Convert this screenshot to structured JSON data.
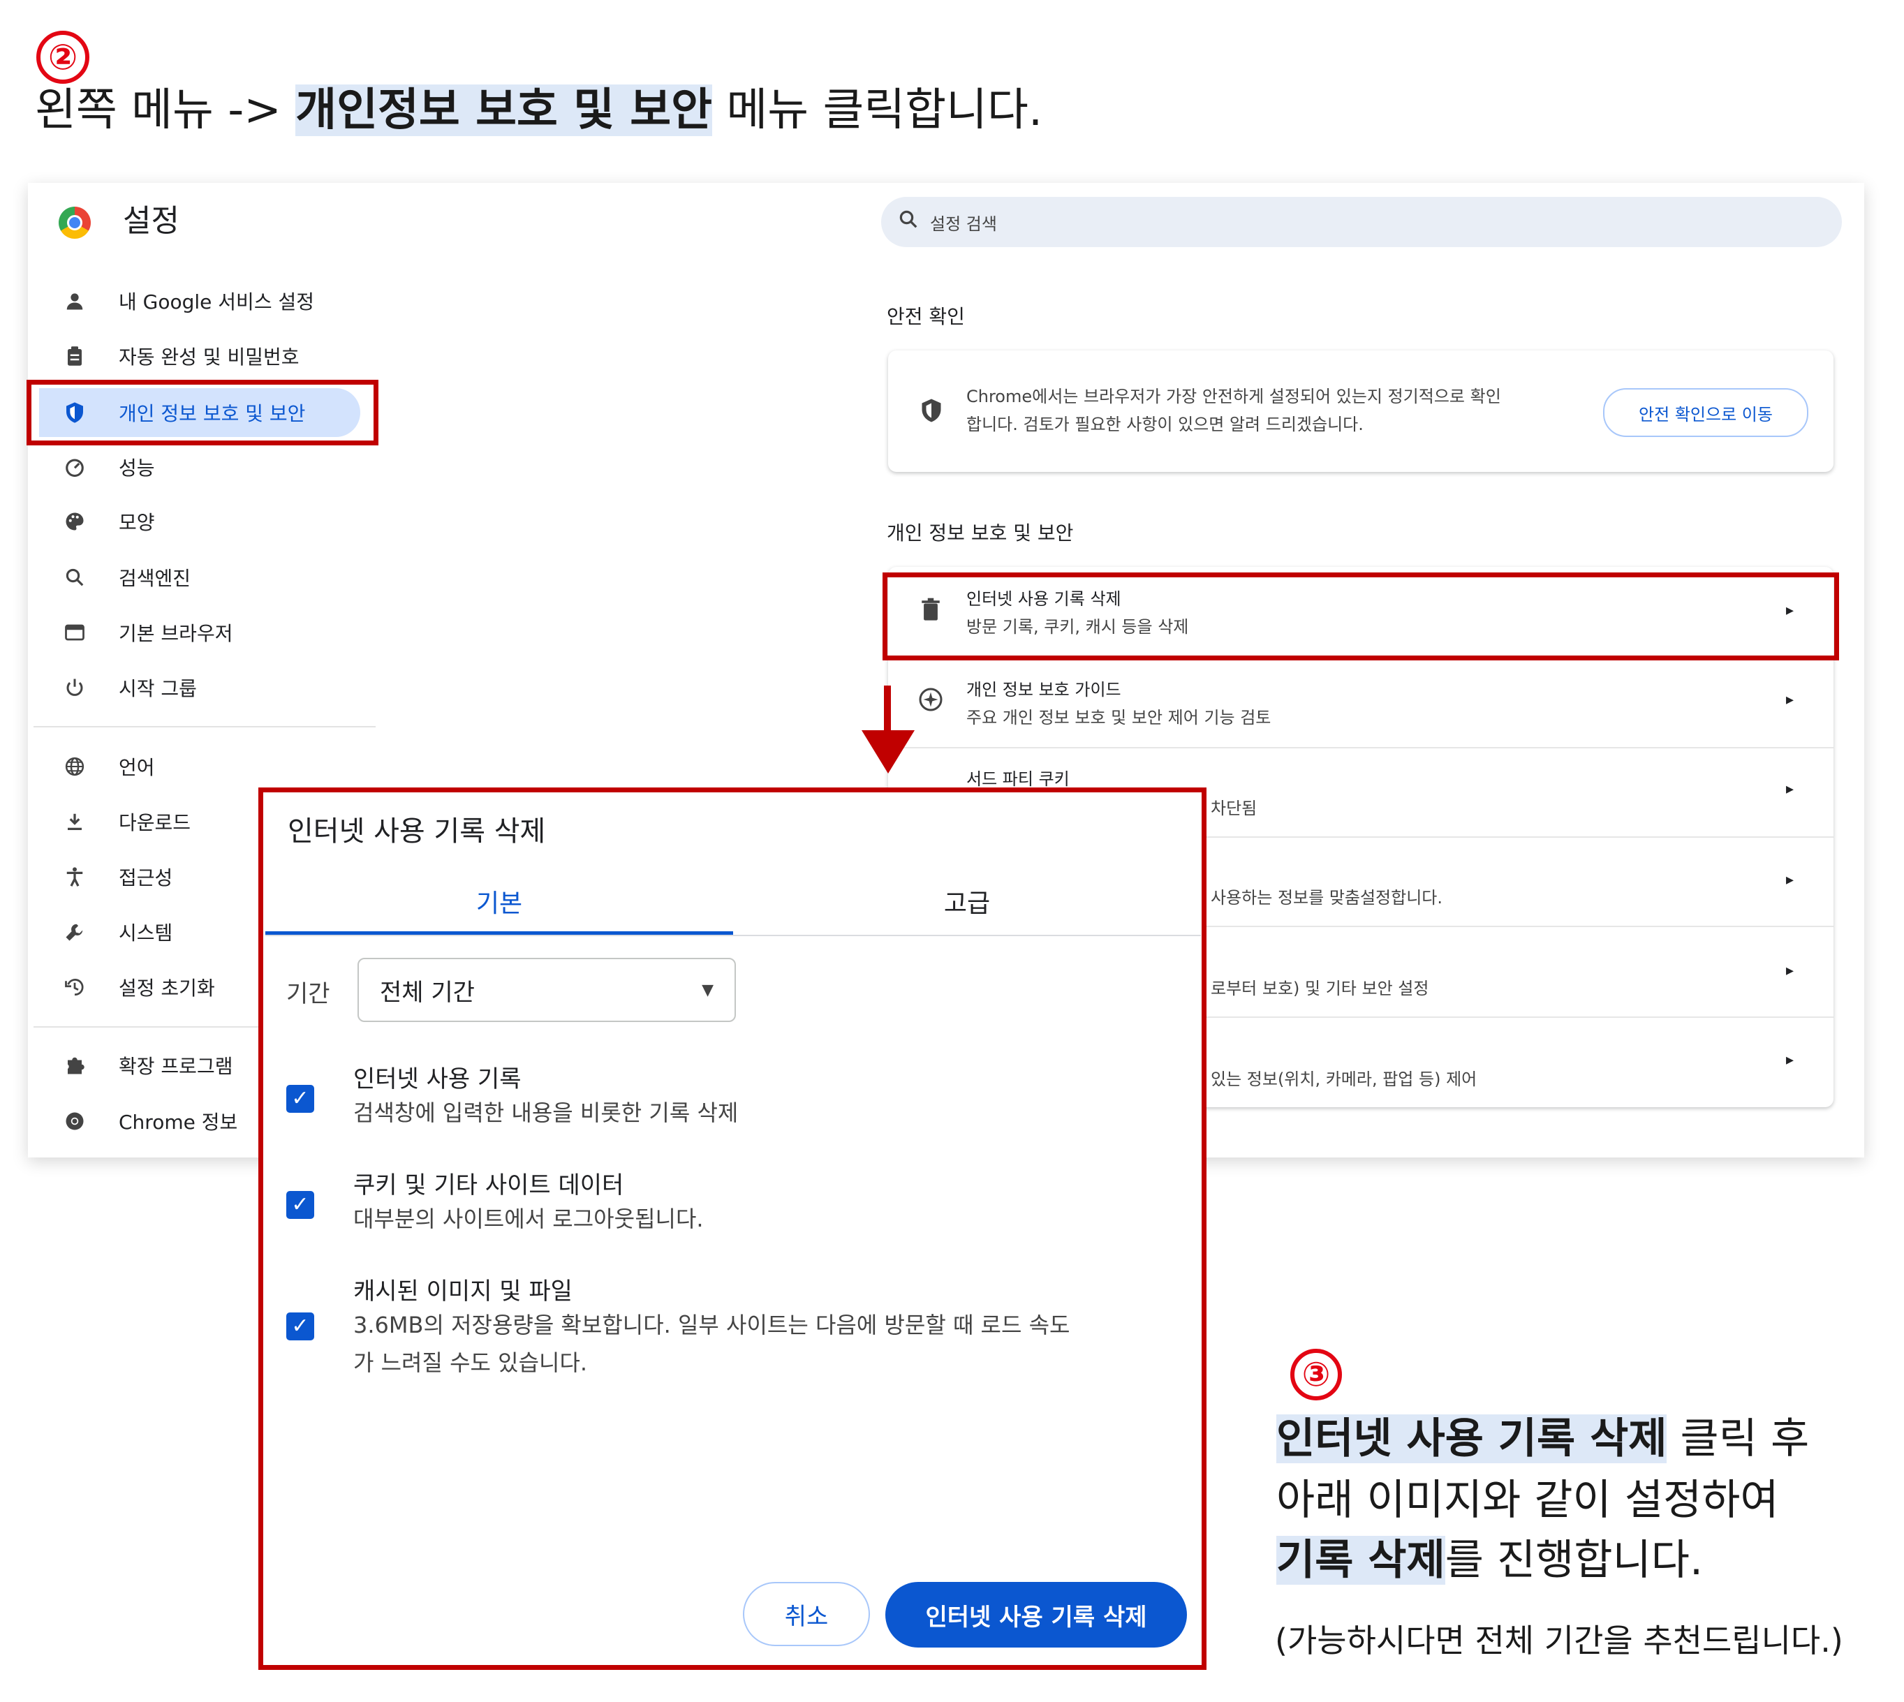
{
  "step2": {
    "number": "②",
    "prefix": "왼쪽 메뉴 -> ",
    "highlight": "개인정보 보호 및 보안",
    "suffix": " 메뉴 클릭합니다."
  },
  "settings": {
    "title": "설정",
    "search_placeholder": "설정 검색",
    "sidebar": {
      "items": [
        {
          "label": "내 Google 서비스 설정",
          "icon": "person-icon"
        },
        {
          "label": "자동 완성 및 비밀번호",
          "icon": "clipboard-icon"
        },
        {
          "label": "개인 정보 보호 및 보안",
          "icon": "shield-icon"
        },
        {
          "label": "성능",
          "icon": "gauge-icon"
        },
        {
          "label": "모양",
          "icon": "palette-icon"
        },
        {
          "label": "검색엔진",
          "icon": "search-icon"
        },
        {
          "label": "기본 브라우저",
          "icon": "browser-icon"
        },
        {
          "label": "시작 그룹",
          "icon": "power-icon"
        },
        {
          "label": "언어",
          "icon": "globe-icon"
        },
        {
          "label": "다운로드",
          "icon": "download-icon"
        },
        {
          "label": "접근성",
          "icon": "accessibility-icon"
        },
        {
          "label": "시스템",
          "icon": "wrench-icon"
        },
        {
          "label": "설정 초기화",
          "icon": "history-icon"
        },
        {
          "label": "확장 프로그램",
          "icon": "puzzle-icon"
        },
        {
          "label": "Chrome 정보",
          "icon": "chrome-icon"
        }
      ]
    },
    "safety_check": {
      "section_title": "안전 확인",
      "line1": "Chrome에서는 브라우저가 가장 안전하게 설정되어 있는지 정기적으로 확인",
      "line2": "합니다. 검토가 필요한 사항이 있으면 알려 드리겠습니다.",
      "button": "안전 확인으로 이동"
    },
    "privacy": {
      "section_title": "개인 정보 보호 및 보안",
      "rows": [
        {
          "title": "인터넷 사용 기록 삭제",
          "sub": "방문 기록, 쿠키, 캐시 등을 삭제"
        },
        {
          "title": "개인 정보 보호 가이드",
          "sub": "주요 개인 정보 보호 및 보안 제어 기능 검토"
        },
        {
          "title": "서드 파티 쿠키",
          "sub": "차단됨"
        },
        {
          "sub": "사용하는 정보를 맞춤설정합니다."
        },
        {
          "sub": "로부터 보호) 및 기타 보안 설정"
        },
        {
          "sub": "있는 정보(위치, 카메라, 팝업 등) 제어"
        }
      ]
    }
  },
  "dialog": {
    "title": "인터넷 사용 기록 삭제",
    "tab_basic": "기본",
    "tab_advanced": "고급",
    "period_label": "기간",
    "period_value": "전체 기간",
    "options": [
      {
        "title": "인터넷 사용 기록",
        "sub": "검색창에 입력한 내용을 비롯한 기록 삭제",
        "checked": true
      },
      {
        "title": "쿠키 및 기타 사이트 데이터",
        "sub": "대부분의 사이트에서 로그아웃됩니다.",
        "checked": true
      },
      {
        "title": "캐시된 이미지 및 파일",
        "sub": "3.6MB의 저장용량을 확보합니다. 일부 사이트는 다음에 방문할 때 로드 속도",
        "sub2": "가 느려질 수도 있습니다.",
        "checked": true
      }
    ],
    "cancel": "취소",
    "confirm": "인터넷 사용 기록 삭제"
  },
  "step3": {
    "number": "③",
    "line1_bold": "인터넷 사용 기록 삭제",
    "line1_rest": " 클릭 후",
    "line2": "아래 이미지와 같이 설정하여",
    "line3_bold": "기록 삭제",
    "line3_rest": "를 진행합니다.",
    "note": "(가능하시다면 전체 기간을 추천드립니다.)"
  },
  "colors": {
    "accent_red": "#c00000",
    "accent_blue": "#0b57d0",
    "highlight": "#dde8f7"
  }
}
